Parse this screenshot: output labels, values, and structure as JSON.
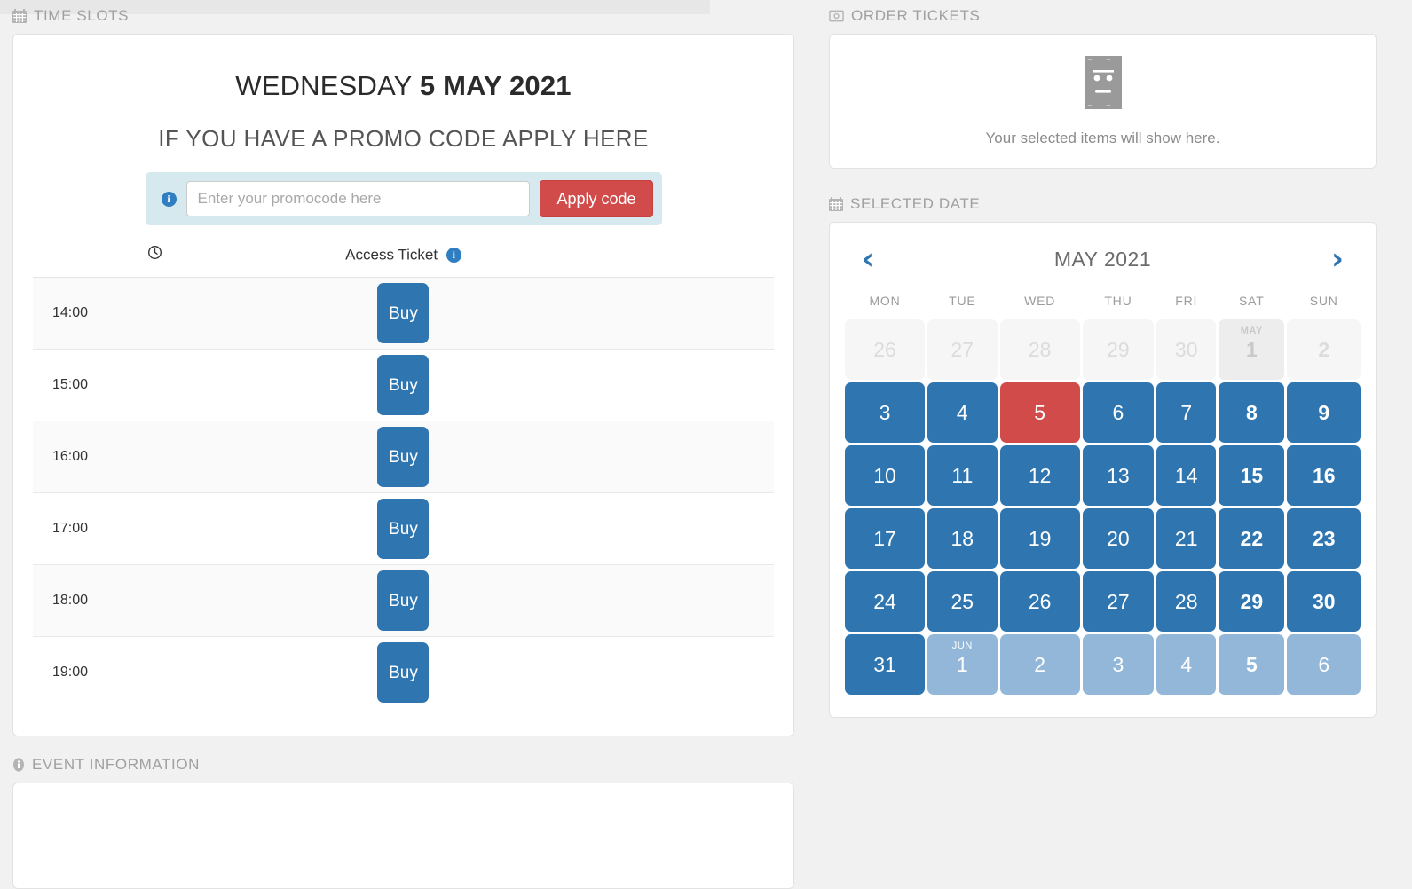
{
  "sections": {
    "time_slots": {
      "label": "TIME SLOTS",
      "icon": "calendar-icon"
    },
    "event_information": {
      "label": "EVENT INFORMATION",
      "icon": "info-icon"
    },
    "order_tickets": {
      "label": "ORDER TICKETS",
      "icon": "money-icon"
    },
    "selected_date": {
      "label": "SELECTED DATE",
      "icon": "calendar-icon"
    }
  },
  "time_slots": {
    "day_name": "WEDNESDAY",
    "date_text": "5 MAY 2021",
    "promo_heading": "IF YOU HAVE A PROMO CODE APPLY HERE",
    "promo": {
      "info_glyph": "i",
      "input_value": "",
      "placeholder": "Enter your promocode here",
      "apply_label": "Apply code"
    },
    "table": {
      "time_header_icon": "clock-icon",
      "ticket_header": "Access Ticket",
      "ticket_header_info_glyph": "i",
      "buy_label": "Buy",
      "rows": [
        {
          "time": "14:00",
          "action": "Buy"
        },
        {
          "time": "15:00",
          "action": "Buy"
        },
        {
          "time": "16:00",
          "action": "Buy"
        },
        {
          "time": "17:00",
          "action": "Buy"
        },
        {
          "time": "18:00",
          "action": "Buy"
        },
        {
          "time": "19:00",
          "action": "Buy"
        }
      ]
    }
  },
  "order_tickets": {
    "icon": "ticket-face-icon",
    "empty_text": "Your selected items will show here."
  },
  "calendar": {
    "prev_glyph": "‹",
    "next_glyph": "›",
    "title": "MAY 2021",
    "weekdays": [
      "MON",
      "TUE",
      "WED",
      "THU",
      "FRI",
      "SAT",
      "SUN"
    ],
    "weeks": [
      [
        {
          "day": "26",
          "state": "prev"
        },
        {
          "day": "27",
          "state": "prev"
        },
        {
          "day": "28",
          "state": "prev"
        },
        {
          "day": "29",
          "state": "prev"
        },
        {
          "day": "30",
          "state": "prev"
        },
        {
          "day": "1",
          "state": "prev",
          "month_tag": "MAY",
          "bold": true
        },
        {
          "day": "2",
          "state": "prev",
          "bold": true
        }
      ],
      [
        {
          "day": "3",
          "state": "cur"
        },
        {
          "day": "4",
          "state": "cur"
        },
        {
          "day": "5",
          "state": "sel"
        },
        {
          "day": "6",
          "state": "cur"
        },
        {
          "day": "7",
          "state": "cur"
        },
        {
          "day": "8",
          "state": "cur",
          "bold": true
        },
        {
          "day": "9",
          "state": "cur",
          "bold": true
        }
      ],
      [
        {
          "day": "10",
          "state": "cur"
        },
        {
          "day": "11",
          "state": "cur"
        },
        {
          "day": "12",
          "state": "cur"
        },
        {
          "day": "13",
          "state": "cur"
        },
        {
          "day": "14",
          "state": "cur"
        },
        {
          "day": "15",
          "state": "cur",
          "bold": true
        },
        {
          "day": "16",
          "state": "cur",
          "bold": true
        }
      ],
      [
        {
          "day": "17",
          "state": "cur"
        },
        {
          "day": "18",
          "state": "cur"
        },
        {
          "day": "19",
          "state": "cur"
        },
        {
          "day": "20",
          "state": "cur"
        },
        {
          "day": "21",
          "state": "cur"
        },
        {
          "day": "22",
          "state": "cur",
          "bold": true
        },
        {
          "day": "23",
          "state": "cur",
          "bold": true
        }
      ],
      [
        {
          "day": "24",
          "state": "cur"
        },
        {
          "day": "25",
          "state": "cur"
        },
        {
          "day": "26",
          "state": "cur"
        },
        {
          "day": "27",
          "state": "cur"
        },
        {
          "day": "28",
          "state": "cur"
        },
        {
          "day": "29",
          "state": "cur",
          "bold": true
        },
        {
          "day": "30",
          "state": "cur",
          "bold": true
        }
      ],
      [
        {
          "day": "31",
          "state": "cur"
        },
        {
          "day": "1",
          "state": "next",
          "month_tag": "JUN"
        },
        {
          "day": "2",
          "state": "next"
        },
        {
          "day": "3",
          "state": "next"
        },
        {
          "day": "4",
          "state": "next"
        },
        {
          "day": "5",
          "state": "next",
          "bold": true
        },
        {
          "day": "6",
          "state": "next"
        }
      ]
    ]
  },
  "colors": {
    "primary_blue": "#2f75b0",
    "selected_red": "#d24b4b",
    "next_month_blue": "#92b7d8",
    "page_bg": "#f1f1f1"
  }
}
